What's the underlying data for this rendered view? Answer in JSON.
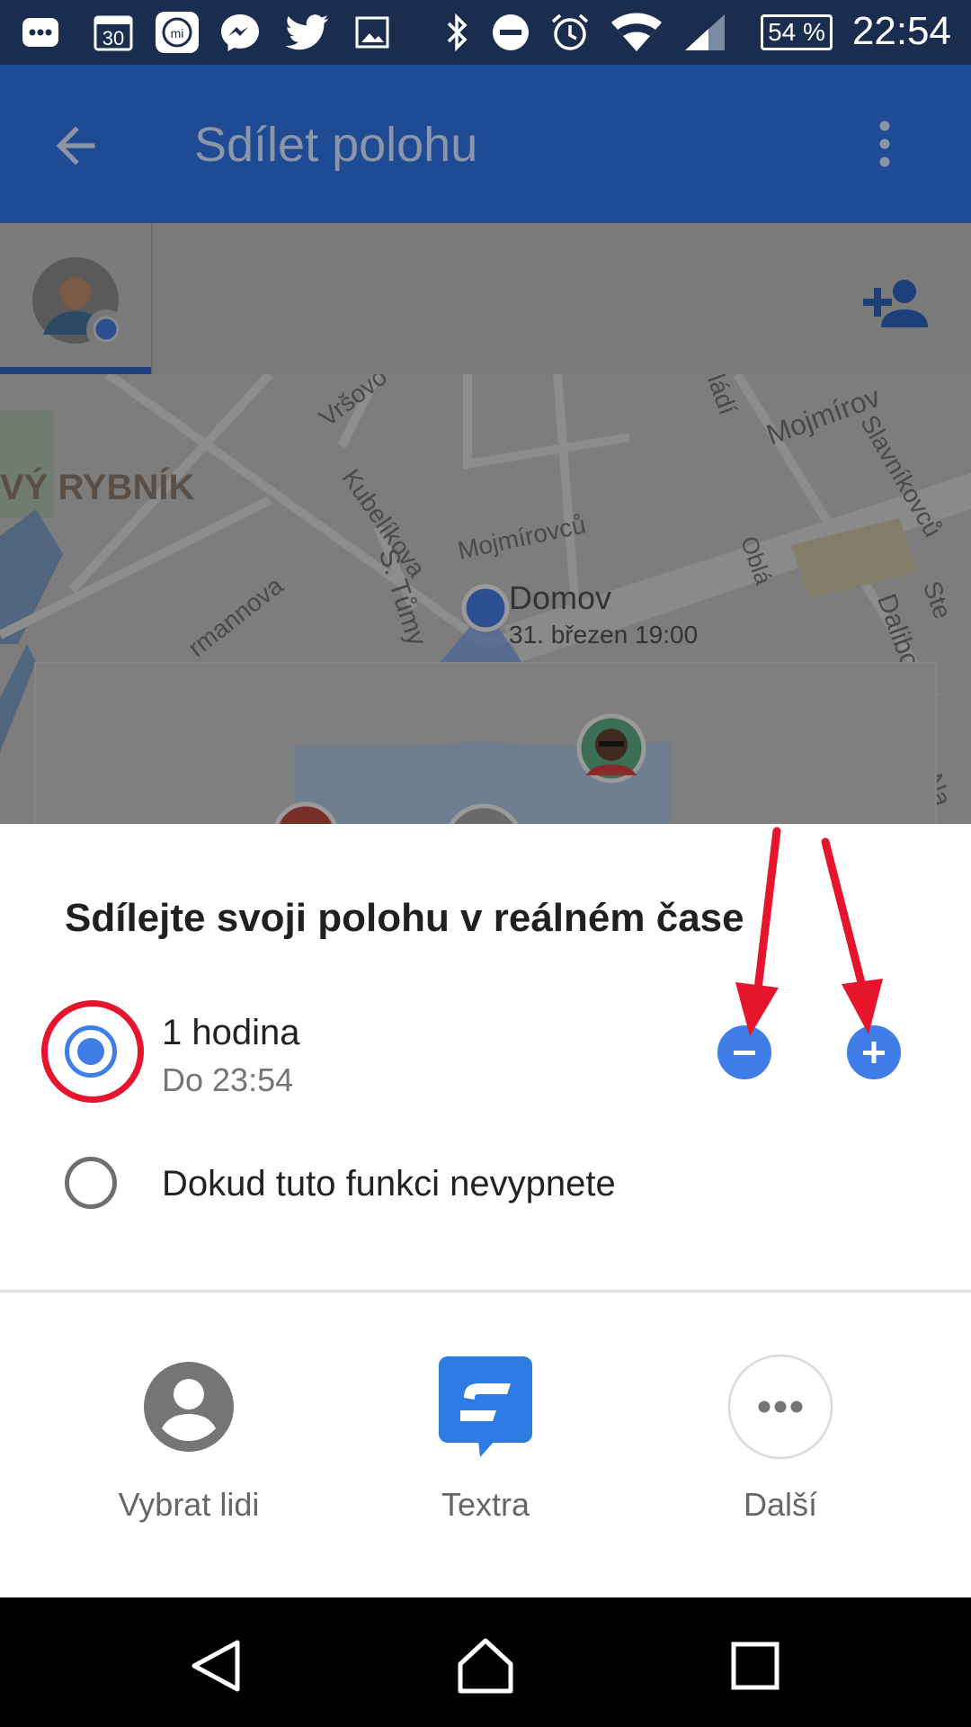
{
  "status_bar": {
    "icons": [
      "more-icon",
      "calendar-30-icon",
      "mi-fit-icon",
      "messenger-icon",
      "twitter-icon",
      "gallery-icon",
      "bluetooth-icon",
      "do-not-disturb-icon",
      "alarm-icon",
      "wifi-icon",
      "signal-icon"
    ],
    "calendar_day": "30",
    "mi_text": "mi",
    "battery": "54 %",
    "time": "22:54"
  },
  "app_bar": {
    "title": "Sdílet polohu",
    "back_icon": "arrow-back-icon",
    "menu_icon": "more-vert-icon",
    "color": "#2b5fc4"
  },
  "people_strip": {
    "add_icon": "person-add-icon"
  },
  "map": {
    "district": "VÝ RYBNÍK",
    "streets": [
      "Vršovo",
      "Kubelíkova",
      "Mojmírovců",
      "S. Tůmy",
      "rmannova",
      "Mojmírov",
      "Slavníkovců",
      "Oblá",
      "Dalibor",
      "ládí",
      "Na",
      "Ste"
    ],
    "place_name": "Domov",
    "place_time": "31. březen 19:00"
  },
  "sheet": {
    "heading": "Sdílejte svoji polohu v reálném čase",
    "option_duration": {
      "label": "1 hodina",
      "sublabel": "Do 23:54",
      "selected": true
    },
    "option_forever": {
      "label": "Dokud tuto funkci nevypnete",
      "selected": false
    },
    "decrease_icon": "minus-icon",
    "increase_icon": "plus-icon",
    "accent": "#3f7ee8",
    "annotation_color": "#e6152b"
  },
  "share_targets": [
    {
      "label": "Vybrat lidi",
      "icon": "account-circle-icon"
    },
    {
      "label": "Textra",
      "icon": "textra-app-icon"
    },
    {
      "label": "Další",
      "icon": "more-horiz-icon"
    }
  ],
  "nav_bar": {
    "icons": [
      "nav-back-icon",
      "nav-home-icon",
      "nav-recents-icon"
    ]
  }
}
